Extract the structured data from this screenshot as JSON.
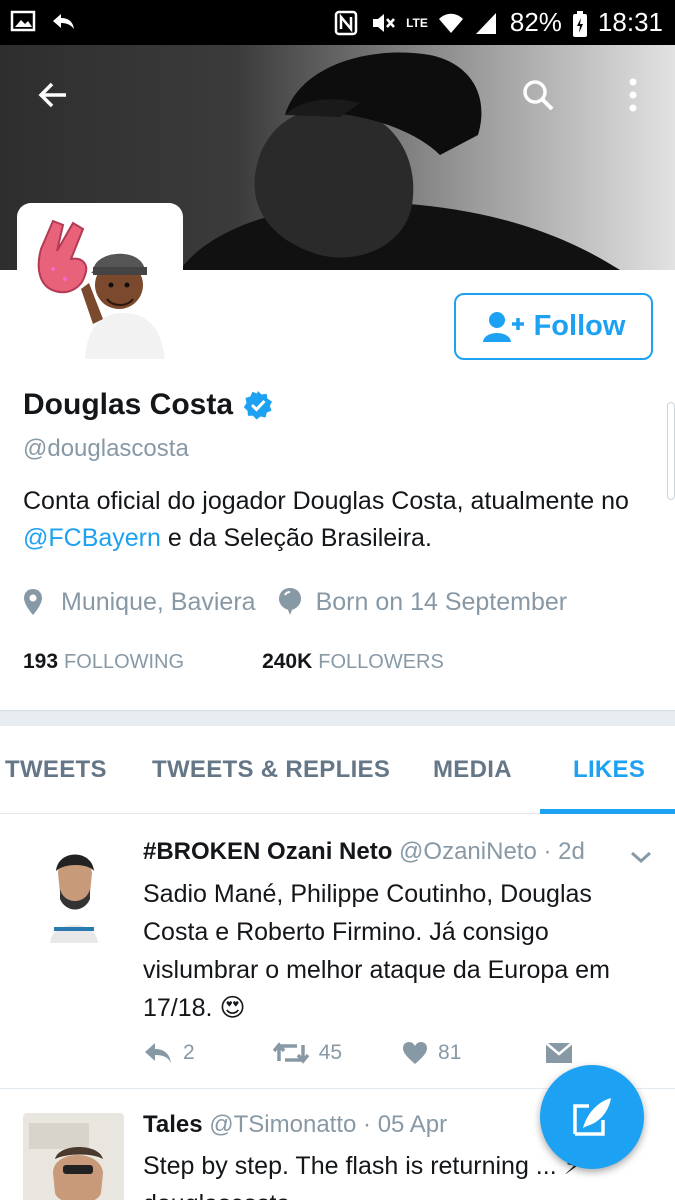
{
  "status_bar": {
    "battery": "82%",
    "time": "18:31",
    "network": "LTE"
  },
  "profile": {
    "name": "Douglas Costa",
    "handle": "@douglascosta",
    "bio_part1": "Conta oficial do jogador Douglas Costa, atualmente no ",
    "bio_link": "@FCBayern",
    "bio_part2": " e da Seleção Brasileira.",
    "location": "Munique, Baviera",
    "birthday": "Born on 14 September",
    "following_count": "193",
    "following_label": "FOLLOWING",
    "followers_count": "240K",
    "followers_label": "FOLLOWERS",
    "follow_button": "Follow"
  },
  "tabs": [
    {
      "label": "TWEETS"
    },
    {
      "label": "TWEETS & REPLIES"
    },
    {
      "label": "MEDIA"
    },
    {
      "label": "LIKES"
    }
  ],
  "active_tab": "LIKES",
  "tweets": [
    {
      "name": "#BROKEN Ozani Neto",
      "handle": "@OzaniNeto",
      "time": "· 2d",
      "text": "Sadio Mané, Philippe Coutinho, Douglas Costa e Roberto Firmino. Já consigo vislumbrar o melhor ataque da Europa em 17/18. 😍",
      "replies": "2",
      "retweets": "45",
      "likes": "81"
    },
    {
      "name": "Tales",
      "handle": "@TSimonatto",
      "time": "· 05 Apr",
      "text": "Step by step. The flash is returning ... ⚡ douglascosta"
    }
  ],
  "colors": {
    "accent": "#1da1f2",
    "muted": "#8899a6",
    "text": "#14171a"
  }
}
